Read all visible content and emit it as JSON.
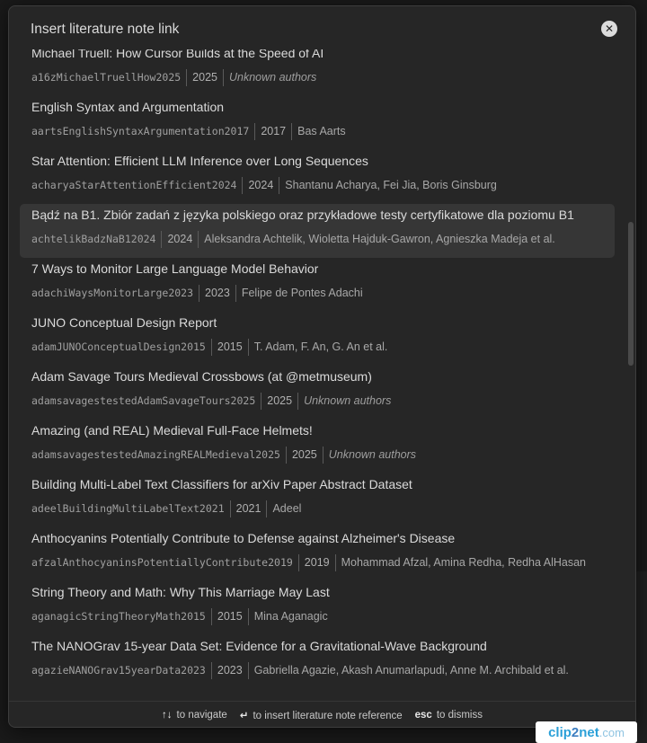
{
  "modal": {
    "title": "Insert literature note link",
    "close_label": "✕"
  },
  "items": [
    {
      "title": "Michael Truell: How Cursor Builds at the Speed of AI",
      "citekey": "a16zMichaelTruellHow2025",
      "year": "2025",
      "authors": "Unknown authors",
      "authors_unknown": true,
      "selected": false
    },
    {
      "title": "English Syntax and Argumentation",
      "citekey": "aartsEnglishSyntaxArgumentation2017",
      "year": "2017",
      "authors": "Bas Aarts",
      "authors_unknown": false,
      "selected": false
    },
    {
      "title": "Star Attention: Efficient LLM Inference over Long Sequences",
      "citekey": "acharyaStarAttentionEfficient2024",
      "year": "2024",
      "authors": "Shantanu Acharya, Fei Jia, Boris Ginsburg",
      "authors_unknown": false,
      "selected": false
    },
    {
      "title": "Bądź na B1. Zbiór zadań z języka polskiego oraz przykładowe testy certyfikatowe dla poziomu B1",
      "citekey": "achtelikBadzNaB12024",
      "year": "2024",
      "authors": "Aleksandra Achtelik, Wioletta Hajduk-Gawron, Agnieszka Madeja et al.",
      "authors_unknown": false,
      "selected": true
    },
    {
      "title": "7 Ways to Monitor Large Language Model Behavior",
      "citekey": "adachiWaysMonitorLarge2023",
      "year": "2023",
      "authors": "Felipe de Pontes Adachi",
      "authors_unknown": false,
      "selected": false
    },
    {
      "title": "JUNO Conceptual Design Report",
      "citekey": "adamJUNOConceptualDesign2015",
      "year": "2015",
      "authors": "T. Adam, F. An, G. An et al.",
      "authors_unknown": false,
      "selected": false
    },
    {
      "title": "Adam Savage Tours Medieval Crossbows (at @metmuseum)",
      "citekey": "adamsavagestestedAdamSavageTours2025",
      "year": "2025",
      "authors": "Unknown authors",
      "authors_unknown": true,
      "selected": false
    },
    {
      "title": "Amazing (and REAL) Medieval Full-Face Helmets!",
      "citekey": "adamsavagestestedAmazingREALMedieval2025",
      "year": "2025",
      "authors": "Unknown authors",
      "authors_unknown": true,
      "selected": false
    },
    {
      "title": "Building Multi-Label Text Classifiers for arXiv Paper Abstract Dataset",
      "citekey": "adeelBuildingMultiLabelText2021",
      "year": "2021",
      "authors": "Adeel",
      "authors_unknown": false,
      "selected": false
    },
    {
      "title": "Anthocyanins Potentially Contribute to Defense against Alzheimer's Disease",
      "citekey": "afzalAnthocyaninsPotentiallyContribute2019",
      "year": "2019",
      "authors": "Mohammad Afzal, Amina Redha, Redha AlHasan",
      "authors_unknown": false,
      "selected": false
    },
    {
      "title": "String Theory and Math: Why This Marriage May Last",
      "citekey": "aganagicStringTheoryMath2015",
      "year": "2015",
      "authors": "Mina Aganagic",
      "authors_unknown": false,
      "selected": false
    },
    {
      "title": "The NANOGrav 15-year Data Set: Evidence for a Gravitational-Wave Background",
      "citekey": "agazieNANOGrav15yearData2023",
      "year": "2023",
      "authors": "Gabriella Agazie, Akash Anumarlapudi, Anne M. Archibald et al.",
      "authors_unknown": false,
      "selected": false
    }
  ],
  "footer": {
    "navigate_key": "↑↓",
    "navigate_text": "to navigate",
    "insert_key": "↵",
    "insert_text": "to insert literature note reference",
    "dismiss_key": "esc",
    "dismiss_text": "to dismiss"
  },
  "watermark": {
    "part1": "clip",
    "part2": "2",
    "part3": "net",
    "part4": ".com"
  }
}
